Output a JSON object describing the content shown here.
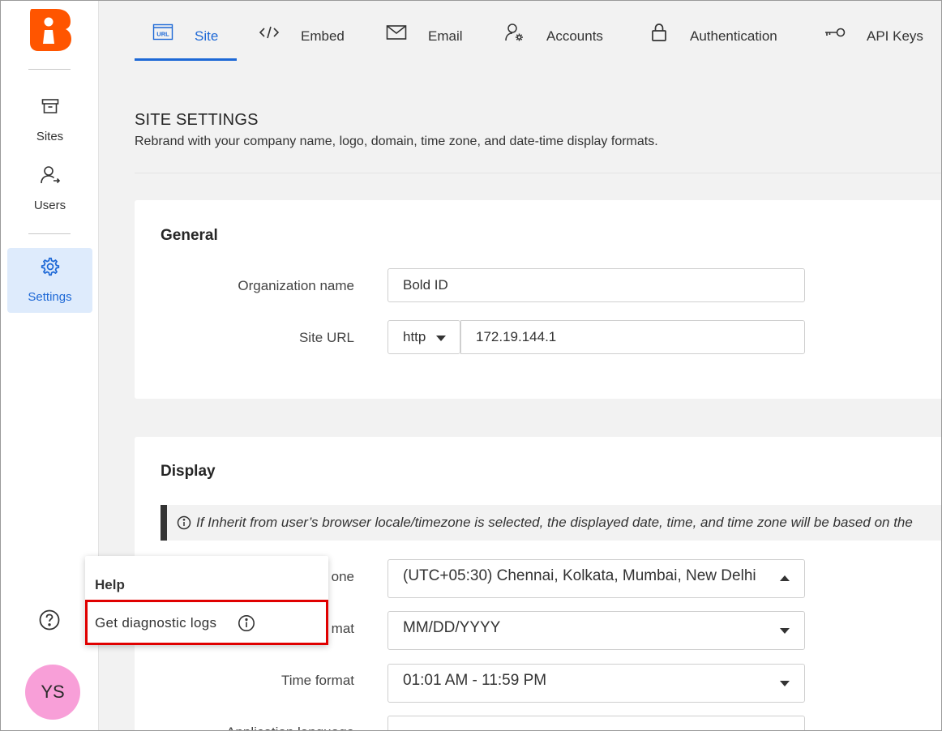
{
  "sidebar": {
    "logo_letter": "B",
    "items": [
      {
        "label": "Sites",
        "icon": "archive-box-icon"
      },
      {
        "label": "Users",
        "icon": "users-icon"
      },
      {
        "label": "Settings",
        "icon": "gear-icon"
      }
    ],
    "help_icon": "question-circle-icon",
    "avatar_initials": "YS"
  },
  "tabs": [
    {
      "label": "Site",
      "icon": "url-icon",
      "active": true
    },
    {
      "label": "Embed",
      "icon": "code-icon"
    },
    {
      "label": "Email",
      "icon": "envelope-icon"
    },
    {
      "label": "Accounts",
      "icon": "user-gear-icon"
    },
    {
      "label": "Authentication",
      "icon": "lock-icon"
    },
    {
      "label": "API Keys",
      "icon": "key-icon"
    }
  ],
  "header": {
    "title": "SITE SETTINGS",
    "subtitle": "Rebrand with your company name, logo, domain, time zone, and date-time display formats."
  },
  "general": {
    "title": "General",
    "org_label": "Organization name",
    "org_value": "Bold ID",
    "url_label": "Site URL",
    "protocol": "http",
    "url_value": "172.19.144.1"
  },
  "display": {
    "title": "Display",
    "info": "If Inherit from user’s browser locale/timezone is selected, the displayed date, time, and time zone will be based on the",
    "timezone_label": "one",
    "timezone_value": "(UTC+05:30) Chennai, Kolkata, Mumbai, New Delhi",
    "date_label": "mat",
    "date_value": "MM/DD/YYYY",
    "time_label": "Time format",
    "time_value": "01:01 AM - 11:59 PM",
    "lang_label": "Application language"
  },
  "help_popup": {
    "title": "Help",
    "item_label": "Get diagnostic logs",
    "item_icon": "info-circle-icon"
  },
  "colors": {
    "accent": "#1d68d6",
    "logo": "#ff5500",
    "avatar": "#f89fd8",
    "highlight": "#e00000"
  }
}
